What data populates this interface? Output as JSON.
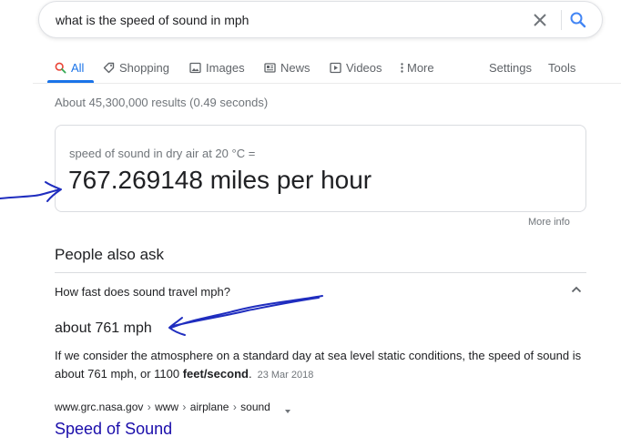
{
  "search": {
    "query": "what is the speed of sound in mph"
  },
  "tabs": [
    {
      "label": "All",
      "icon": "search-icon",
      "active": true
    },
    {
      "label": "Shopping",
      "icon": "tag-icon"
    },
    {
      "label": "Images",
      "icon": "image-icon"
    },
    {
      "label": "News",
      "icon": "news-icon"
    },
    {
      "label": "Videos",
      "icon": "play-icon"
    },
    {
      "label": "More",
      "icon": "more-vert-icon"
    }
  ],
  "tools": {
    "settings": "Settings",
    "tools": "Tools"
  },
  "stats": "About 45,300,000 results (0.49 seconds)",
  "answer_card": {
    "label": "speed of sound in dry air at 20 °C =",
    "result": "767.269148 miles per hour",
    "more_info": "More info"
  },
  "people_also_ask": {
    "title": "People also ask",
    "question": "How fast does sound travel mph?",
    "answer_heading": "about 761 mph",
    "answer_text_before": "If we consider the atmosphere on a standard day at sea level static conditions, the speed of sound is about 761 mph, or 1100 ",
    "answer_text_bold": "feet/second",
    "answer_text_after": ".",
    "answer_date": "23 Mar 2018",
    "cite": {
      "domain": "www.grc.nasa.gov",
      "path": [
        "www",
        "airplane",
        "sound"
      ],
      "separator": "›"
    },
    "link_title": "Speed of Sound"
  },
  "colors": {
    "accent": "#1a73e8",
    "link": "#1a0dab",
    "annotation": "#1f2dbf",
    "muted": "#70757a"
  }
}
